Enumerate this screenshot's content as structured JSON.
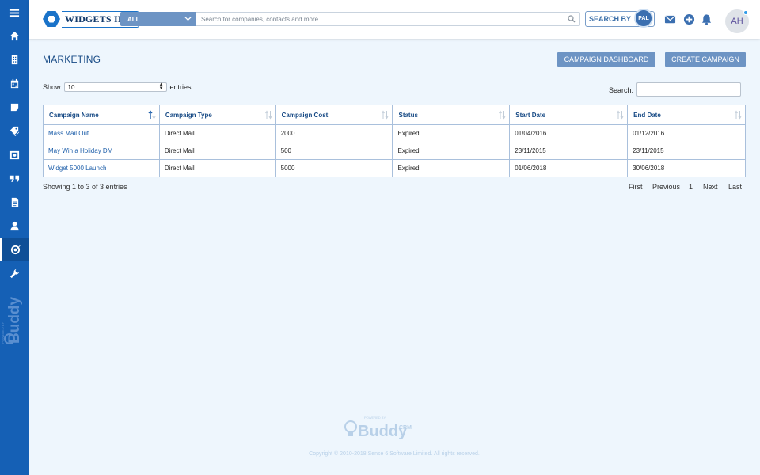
{
  "brand": {
    "name": "WIDGETS INC."
  },
  "search": {
    "scope": "ALL",
    "placeholder": "Search for companies, contacts and more",
    "search_by_label": "SEARCH BY",
    "search_by_badge": "PAL"
  },
  "user": {
    "initials": "AH"
  },
  "sidebar": {
    "items": [
      {
        "name": "menu",
        "icon": "hamburger-icon"
      },
      {
        "name": "home",
        "icon": "home-icon"
      },
      {
        "name": "companies",
        "icon": "building-icon"
      },
      {
        "name": "calendar",
        "icon": "calendar-icon"
      },
      {
        "name": "notes",
        "icon": "note-icon"
      },
      {
        "name": "tags",
        "icon": "tag-icon"
      },
      {
        "name": "opportunities",
        "icon": "archive-icon"
      },
      {
        "name": "quotes",
        "icon": "quote-icon"
      },
      {
        "name": "documents",
        "icon": "document-icon"
      },
      {
        "name": "contacts",
        "icon": "person-icon"
      },
      {
        "name": "marketing",
        "icon": "target-icon",
        "active": true
      },
      {
        "name": "settings",
        "icon": "wrench-icon"
      }
    ],
    "brand_text": "Buddy",
    "brand_powered": "POWERED BY"
  },
  "page": {
    "title": "MARKETING",
    "buttons": {
      "dashboard": "CAMPAIGN DASHBOARD",
      "create": "CREATE CAMPAIGN"
    },
    "show_label": "Show",
    "page_size": "10",
    "entries_label": "entries",
    "search_label": "Search:"
  },
  "table": {
    "columns": [
      "Campaign Name",
      "Campaign Type",
      "Campaign Cost",
      "Status",
      "Start Date",
      "End Date"
    ],
    "rows": [
      [
        "Mass Mail Out",
        "Direct Mail",
        "2000",
        "Expired",
        "01/04/2016",
        "01/12/2016"
      ],
      [
        "May Win a Holiday DM",
        "Direct Mail",
        "500",
        "Expired",
        "23/11/2015",
        "23/11/2015"
      ],
      [
        "Widget 5000 Launch",
        "Direct Mail",
        "5000",
        "Expired",
        "01/06/2018",
        "30/06/2018"
      ]
    ]
  },
  "pagination": {
    "summary": "Showing 1 to 3 of 3 entries",
    "first": "First",
    "previous": "Previous",
    "current": "1",
    "next": "Next",
    "last": "Last"
  },
  "footer": {
    "powered_by": "POWERED BY",
    "brand": "Buddy",
    "brand_suffix": "CRM",
    "copyright": "Copyright © 2010-2018 Sense 6 Software Limited. All rights reserved."
  },
  "colors": {
    "sidebar": "#1560b5",
    "accent_button": "#6d94c4",
    "link": "#1e5faa",
    "background": "#eef6fd"
  }
}
